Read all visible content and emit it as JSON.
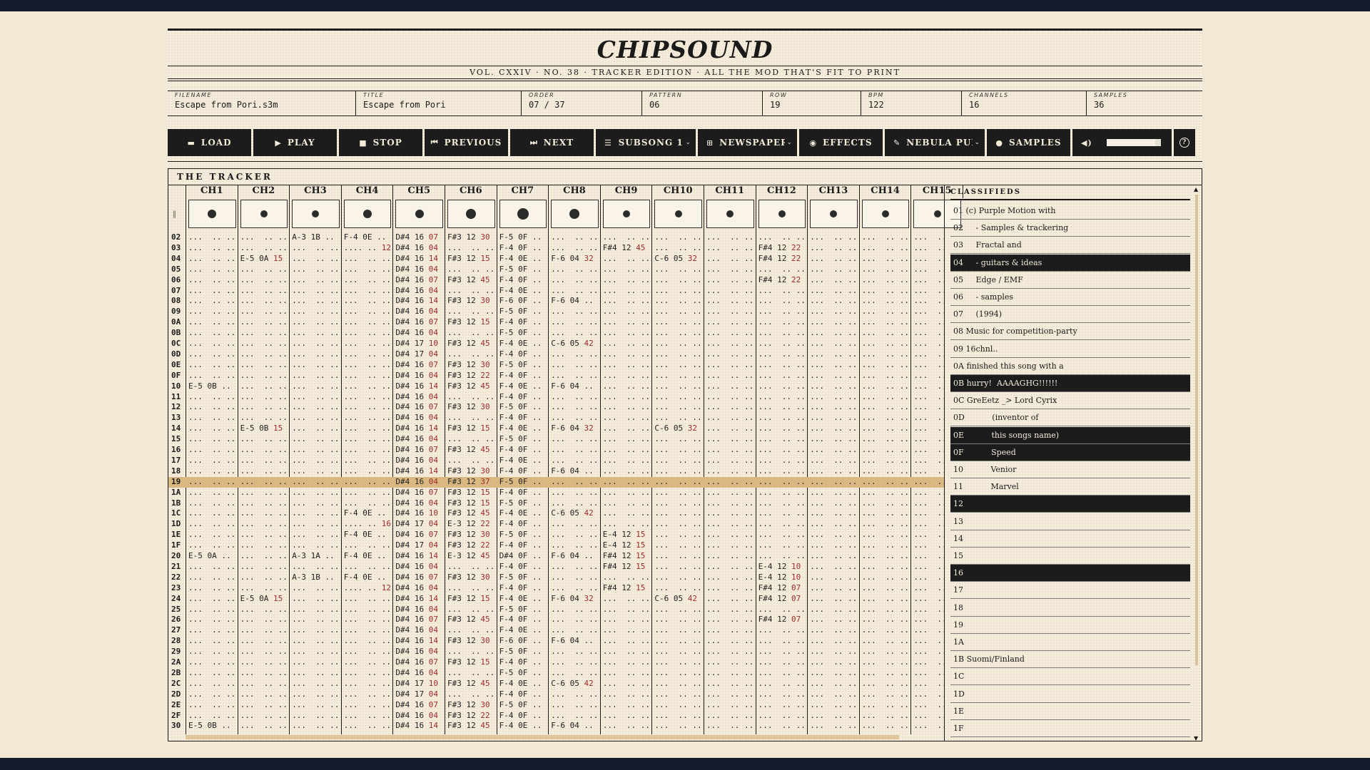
{
  "app": {
    "masthead": "CHIPSOUND",
    "tagline": "VOL. CXXIV · NO. 38 · TRACKER EDITION · ALL THE MOD THAT'S FIT TO PRINT"
  },
  "meta": [
    {
      "label": "FILENAME",
      "value": "Escape from Pori.s3m"
    },
    {
      "label": "TITLE",
      "value": "Escape from Pori"
    },
    {
      "label": "ORDER",
      "value": "07 / 37"
    },
    {
      "label": "PATTERN",
      "value": "06"
    },
    {
      "label": "ROW",
      "value": "19"
    },
    {
      "label": "BPM",
      "value": "122"
    },
    {
      "label": "CHANNELS",
      "value": "16"
    },
    {
      "label": "SAMPLES",
      "value": "36"
    }
  ],
  "toolbar": {
    "load": "LOAD",
    "play": "PLAY",
    "stop": "STOP",
    "previous": "PREVIOUS",
    "next": "NEXT",
    "subsong": "SUBSONG 1",
    "theme": "NEWSPAPER",
    "effects": "EFFECTS",
    "visualizer": "NEBULA PUL",
    "samples": "SAMPLES",
    "volume": 0.9,
    "help": "?"
  },
  "tracker": {
    "title": "THE TRACKER",
    "channels": [
      "CH1",
      "CH2",
      "CH3",
      "CH4",
      "CH5",
      "CH6",
      "CH7",
      "CH8",
      "CH9",
      "CH10",
      "CH11",
      "CH12",
      "CH13",
      "CH14",
      "CH15"
    ],
    "current_row": "19",
    "rows": []
  },
  "classifieds": {
    "title": "CLASSIFIEDS",
    "items": [
      {
        "text": "01 (c) Purple Motion with",
        "inverted": false
      },
      {
        "text": "02     - Samples & trackering",
        "inverted": false
      },
      {
        "text": "03     Fractal and",
        "inverted": false
      },
      {
        "text": "04     - guitars & ideas",
        "inverted": true
      },
      {
        "text": "05     Edge / EMF",
        "inverted": false
      },
      {
        "text": "06     - samples",
        "inverted": false
      },
      {
        "text": "07     (1994)",
        "inverted": false
      },
      {
        "text": "08 Music for competition-party",
        "inverted": false
      },
      {
        "text": "09 16chnl..",
        "inverted": false
      },
      {
        "text": "0A finished this song with a",
        "inverted": false
      },
      {
        "text": "0B hurry!  AAAAGHG!!!!!!",
        "inverted": true
      },
      {
        "text": "0C GreEetz _> Lord Cyrix",
        "inverted": false
      },
      {
        "text": "0D           (inventor of",
        "inverted": false
      },
      {
        "text": "0E           this songs name)",
        "inverted": true
      },
      {
        "text": "0F           Speed",
        "inverted": true
      },
      {
        "text": "10           Venior",
        "inverted": false
      },
      {
        "text": "11           Marvel",
        "inverted": false
      },
      {
        "text": "12",
        "inverted": true
      },
      {
        "text": "13",
        "inverted": false
      },
      {
        "text": "14",
        "inverted": false
      },
      {
        "text": "15",
        "inverted": false
      },
      {
        "text": "16",
        "inverted": true
      },
      {
        "text": "17",
        "inverted": false
      },
      {
        "text": "18",
        "inverted": false
      },
      {
        "text": "19",
        "inverted": false
      },
      {
        "text": "1A",
        "inverted": false
      },
      {
        "text": "1B Suomi/Finland",
        "inverted": false
      },
      {
        "text": "1C",
        "inverted": false
      },
      {
        "text": "1D",
        "inverted": false
      },
      {
        "text": "1E",
        "inverted": false
      },
      {
        "text": "1F",
        "inverted": false
      }
    ]
  },
  "colors": {
    "ink": "#1a1a1a",
    "paper": "#f5ecdb",
    "highlight": "#d9b882",
    "effect": "#9e2b2b",
    "frame": "#131a2a"
  },
  "icons": [
    "folder-icon",
    "play-icon",
    "stop-icon",
    "previous-icon",
    "next-icon",
    "list-icon",
    "grid-icon",
    "effects-icon",
    "wand-icon",
    "samples-icon",
    "speaker-icon",
    "help-icon"
  ]
}
